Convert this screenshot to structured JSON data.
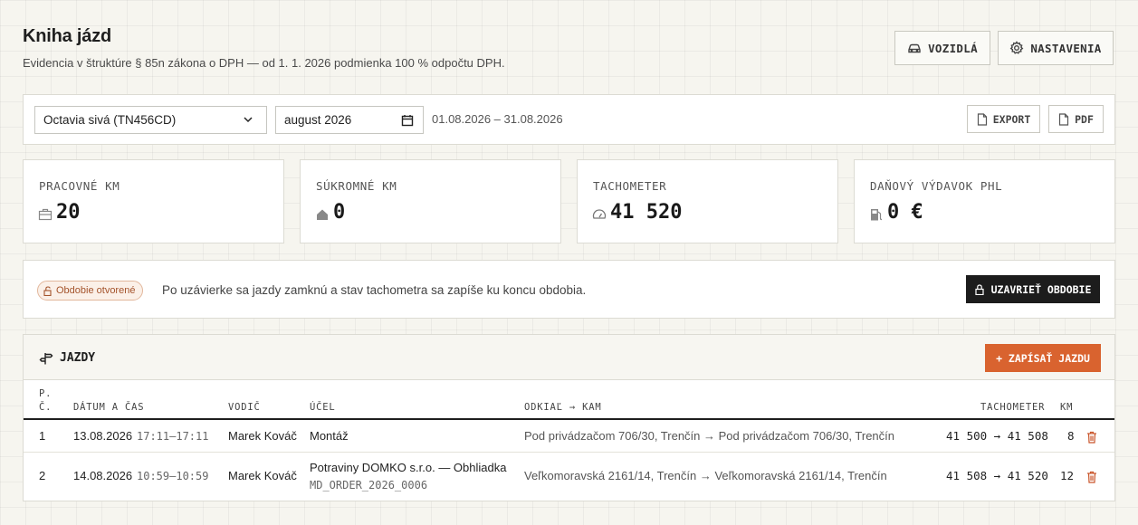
{
  "header": {
    "title": "Kniha jázd",
    "subtitle": "Evidencia v štruktúre § 85n zákona o DPH — od 1. 1. 2026 podmienka 100 % odpočtu DPH.",
    "vehicles_label": "VOZIDLÁ",
    "settings_label": "NASTAVENIA",
    "vehicles_icon": "car-icon",
    "settings_icon": "gear-icon"
  },
  "filters": {
    "vehicle_selected": "Octavia sivá (TN456CD)",
    "month_value": "august 2026",
    "date_range": "01.08.2026 – 31.08.2026",
    "export_label": "EXPORT",
    "pdf_label": "PDF"
  },
  "stats": [
    {
      "label": "PRACOVNÉ KM",
      "value": "20",
      "icon": "briefcase-icon"
    },
    {
      "label": "SÚKROMNÉ KM",
      "value": "0",
      "icon": "home-icon"
    },
    {
      "label": "TACHOMETER",
      "value": "41 520",
      "icon": "gauge-icon"
    },
    {
      "label": "DAŇOVÝ VÝDAVOK PHL",
      "value": "0 €",
      "icon": "fuel-pump-icon"
    }
  ],
  "closure": {
    "badge": "Obdobie otvorené",
    "text": "Po uzávierke sa jazdy zamknú a stav tachometra sa zapíše ku koncu obdobia.",
    "button": "UZAVRIEŤ OBDOBIE"
  },
  "trips": {
    "title": "JAZDY",
    "add_button": "+ ZAPÍSAŤ JAZDU",
    "columns": {
      "no_line1": "P.",
      "no_line2": "Č.",
      "datetime": "DÁTUM A ČAS",
      "driver": "VODIČ",
      "purpose": "ÚČEL",
      "route": "ODKIAĽ → KAM",
      "odometer": "TACHOMETER",
      "km": "KM"
    },
    "rows": [
      {
        "no": "1",
        "date": "13.08.2026",
        "time": "17:11–17:11",
        "driver": "Marek Kováč",
        "purpose": "Montáž",
        "purpose_sub": "",
        "route": "Pod privádzačom 706/30, Trenčín → Pod privádzačom 706/30, Trenčín",
        "odometer": "41 500 → 41 508",
        "km": "8"
      },
      {
        "no": "2",
        "date": "14.08.2026",
        "time": "10:59–10:59",
        "driver": "Marek Kováč",
        "purpose": "Potraviny DOMKO s.r.o. — Obhliadka",
        "purpose_sub": "MD_ORDER_2026_0006",
        "route": "Veľkomoravská 2161/14, Trenčín → Veľkomoravská 2161/14, Trenčín",
        "odometer": "41 508 → 41 520",
        "km": "12"
      }
    ]
  },
  "colors": {
    "accent": "#d9632f",
    "dark": "#1c1c1c",
    "badge_text": "#a4532b",
    "trash": "#c9552a"
  }
}
